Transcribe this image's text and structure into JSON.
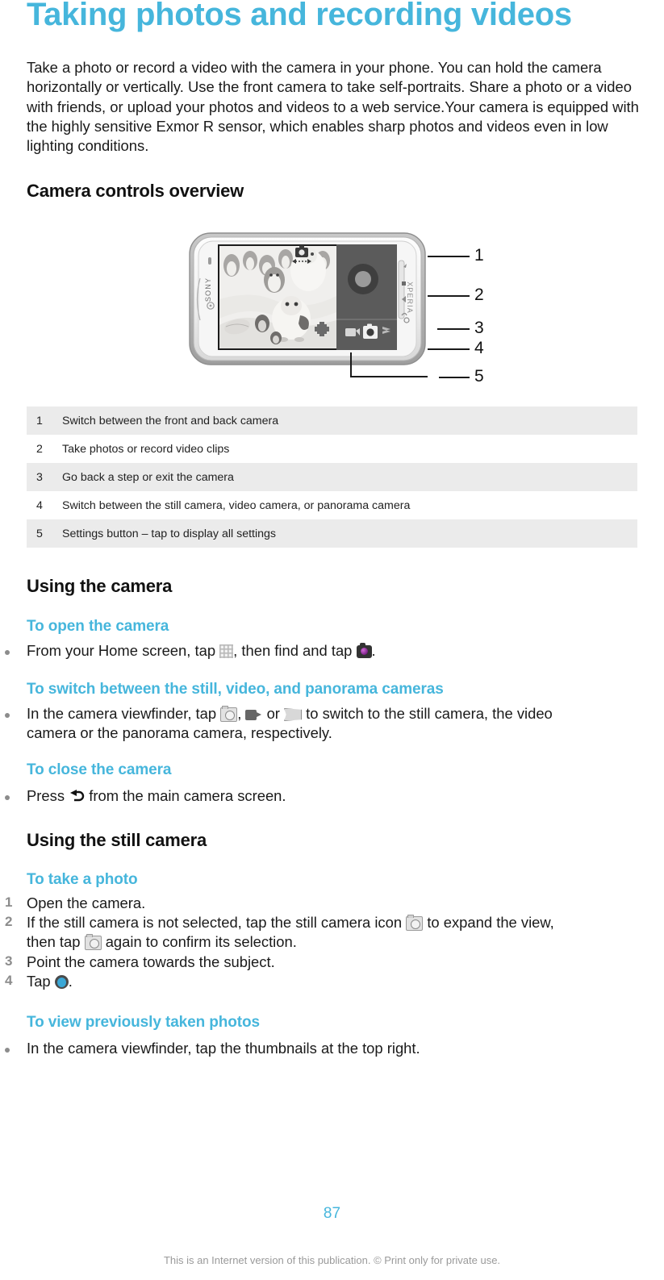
{
  "document": {
    "title": "Taking photos and recording videos",
    "intro": "Take a photo or record a video with the camera in your phone. You can hold the camera horizontally or vertically. Use the front camera to take self-portraits. Share a photo or a video with friends, or upload your photos and videos to a web service.Your camera is equipped with the highly sensitive Exmor R sensor, which enables sharp photos and videos even in low lighting conditions.",
    "page_number": "87",
    "footer_note": "This is an Internet version of this publication. © Print only for private use."
  },
  "colors": {
    "accent": "#46b6dc",
    "body_text": "#1a1a1a",
    "table_shade": "#ebebeb",
    "marker_gray": "#8c8c8c",
    "footer_gray": "#9a9a9a"
  },
  "overview": {
    "heading": "Camera controls overview",
    "figure": {
      "brand": "SONY",
      "side_brand": "XPERIA",
      "callouts": [
        "1",
        "2",
        "3",
        "4",
        "5"
      ]
    },
    "table": {
      "rows": [
        {
          "num": "1",
          "desc": "Switch between the front and back camera"
        },
        {
          "num": "2",
          "desc": "Take photos or record video clips"
        },
        {
          "num": "3",
          "desc": "Go back a step or exit the camera"
        },
        {
          "num": "4",
          "desc": "Switch between the still camera, video camera, or panorama camera"
        },
        {
          "num": "5",
          "desc": "Settings button – tap to display all settings"
        }
      ]
    }
  },
  "using_the_camera": {
    "heading": "Using the camera",
    "open": {
      "heading": "To open the camera",
      "text_a": "From your Home screen, tap ",
      "text_b": ", then find and tap ",
      "text_c": "."
    },
    "switch": {
      "heading": "To switch between the still, video, and panorama cameras",
      "text_a": "In the camera viewfinder, tap ",
      "text_b": ", ",
      "text_c": " or ",
      "text_d": " to switch to the still camera, the video",
      "text_e": "camera or the panorama camera, respectively."
    },
    "close": {
      "heading": "To close the camera",
      "text_a": "Press ",
      "text_b": " from the main camera screen."
    }
  },
  "using_the_still_camera": {
    "heading": "Using the still camera",
    "take_photo": {
      "heading": "To take a photo",
      "markers": [
        "1",
        "2",
        "3",
        "4"
      ],
      "step1": "Open the camera.",
      "step2_a": "If the still camera is not selected, tap the still camera icon ",
      "step2_b": " to expand the view,",
      "step2_c": "then tap ",
      "step2_d": " again to confirm its selection.",
      "step3": "Point the camera towards the subject.",
      "step4_a": "Tap ",
      "step4_b": "."
    },
    "view_photos": {
      "heading": "To view previously taken photos",
      "text": "In the camera viewfinder, tap the thumbnails at the top right."
    }
  },
  "icons": {
    "app_grid": "app-grid-icon",
    "camera_app": "camera-app-icon",
    "still_camera": "still-camera-icon",
    "video_camera": "video-camera-icon",
    "panorama": "panorama-icon",
    "back_arrow": "back-arrow-icon",
    "shutter": "shutter-button-icon"
  }
}
